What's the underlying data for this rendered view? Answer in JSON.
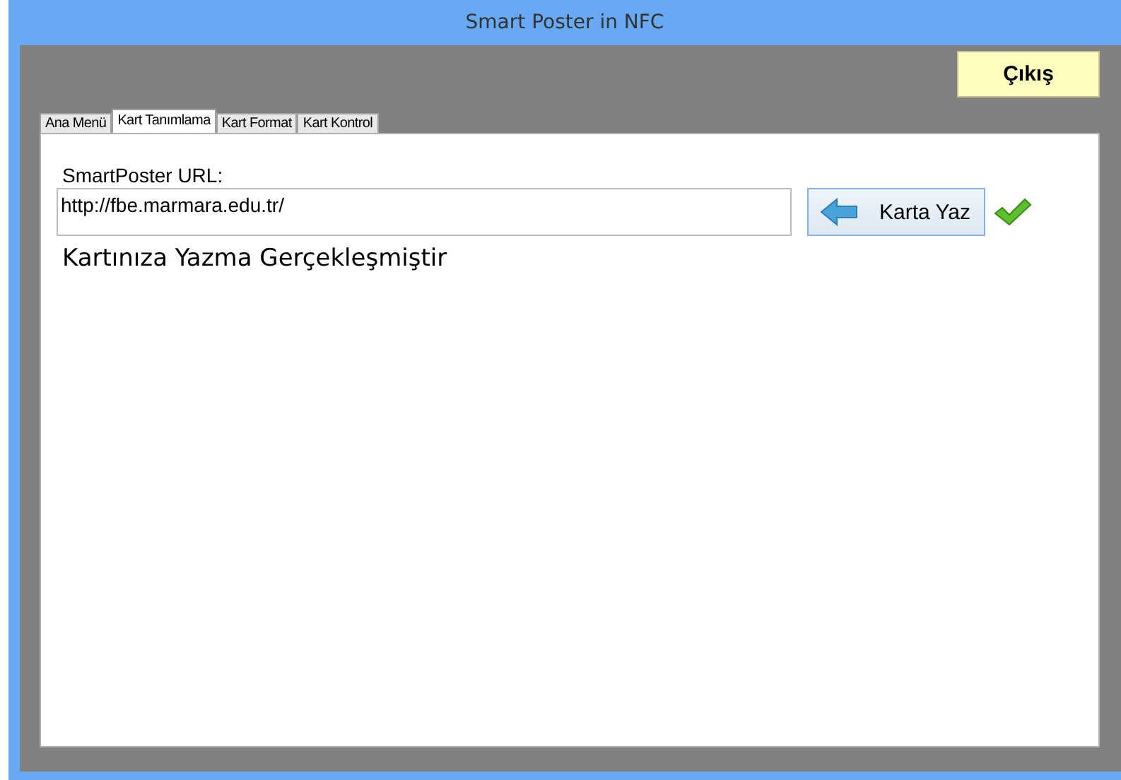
{
  "window": {
    "title": "Smart Poster in NFC"
  },
  "exit_button": "Çıkış",
  "tabs": [
    {
      "label": "Ana Menü",
      "selected": false
    },
    {
      "label": "Kart Tanımlama",
      "selected": true
    },
    {
      "label": "Kart Format",
      "selected": false
    },
    {
      "label": "Kart Kontrol",
      "selected": false
    }
  ],
  "url_label": "SmartPoster URL:",
  "url_field": {
    "value": "http://fbe.marmara.edu.tr/"
  },
  "write_button": "Karta Yaz",
  "success": true,
  "status_message": "Kartınıza Yazma Gerçekleşmiştir"
}
